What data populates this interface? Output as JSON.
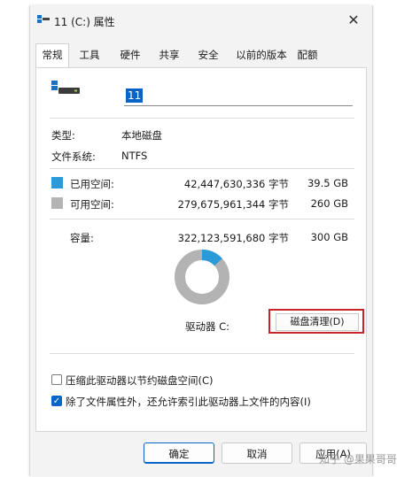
{
  "window": {
    "title": "11 (C:) 属性",
    "close_glyph": "✕"
  },
  "tabs": [
    {
      "label": "常规",
      "active": true
    },
    {
      "label": "工具",
      "active": false
    },
    {
      "label": "硬件",
      "active": false
    },
    {
      "label": "共享",
      "active": false
    },
    {
      "label": "安全",
      "active": false
    },
    {
      "label": "以前的版本",
      "active": false
    },
    {
      "label": "配额",
      "active": false
    }
  ],
  "general": {
    "volume_name": "11",
    "type_label": "类型:",
    "type_value": "本地磁盘",
    "fs_label": "文件系统:",
    "fs_value": "NTFS",
    "used": {
      "label": "已用空间:",
      "bytes": "42,447,630,336 字节",
      "size": "39.5 GB",
      "color": "#2b9ad8"
    },
    "free": {
      "label": "可用空间:",
      "bytes": "279,675,961,344 字节",
      "size": "260 GB",
      "color": "#b3b3b3"
    },
    "capacity": {
      "label": "容量:",
      "bytes": "322,123,591,680 字节",
      "size": "300 GB"
    },
    "used_fraction": 0.132,
    "drive_label": "驱动器 C:",
    "cleanup_button": "磁盘清理(D)",
    "compress_option": {
      "label": "压缩此驱动器以节约磁盘空间(C)",
      "checked": false
    },
    "index_option": {
      "label": "除了文件属性外，还允许索引此驱动器上文件的内容(I)",
      "checked": true
    }
  },
  "footer": {
    "ok": "确定",
    "cancel": "取消",
    "apply": "应用(A)"
  },
  "watermark": "知乎 @果果哥哥",
  "colors": {
    "accent": "#0a64c8",
    "highlight_box": "#c6252a"
  }
}
